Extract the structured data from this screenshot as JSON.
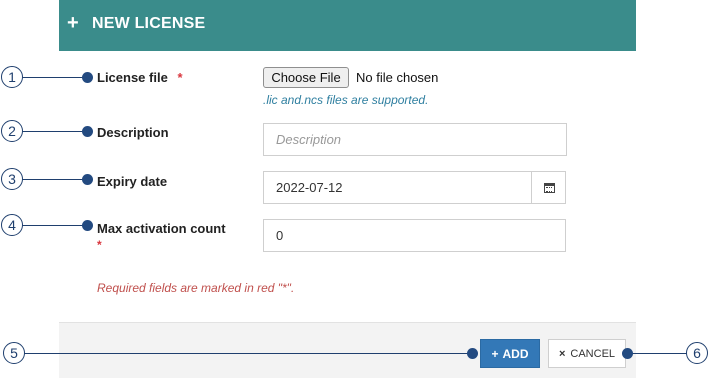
{
  "header": {
    "plus_icon": "+",
    "title": "NEW LICENSE"
  },
  "form": {
    "license_file": {
      "label": "License file",
      "required_mark": "*",
      "button_label": "Choose File",
      "status": "No file chosen",
      "hint": ".lic and.ncs files are supported."
    },
    "description": {
      "label": "Description",
      "placeholder": "Description",
      "value": ""
    },
    "expiry_date": {
      "label": "Expiry date",
      "value": "2022-07-12",
      "icon": "calendar-icon"
    },
    "max_activation": {
      "label": "Max activation count",
      "required_mark": "*",
      "value": "0"
    },
    "required_note": "Required fields are marked in red \"*\"."
  },
  "footer": {
    "add": {
      "icon": "+",
      "label": "ADD"
    },
    "cancel": {
      "icon": "×",
      "label": "CANCEL"
    }
  },
  "callouts": [
    "1",
    "2",
    "3",
    "4",
    "5",
    "6"
  ],
  "colors": {
    "header": "#3a8c8b",
    "primary_button": "#3378b7",
    "required": "#d9363e",
    "hint": "#2f7fa0",
    "callout": "#1f3f6e"
  }
}
